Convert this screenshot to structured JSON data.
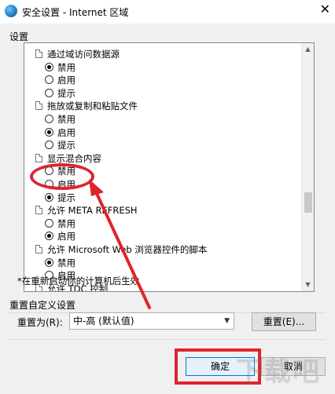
{
  "window": {
    "title": "安全设置 - Internet 区域",
    "close_glyph": "✕"
  },
  "settings_label": "设置",
  "tree": [
    {
      "kind": "heading",
      "label": "通过域访问数据源"
    },
    {
      "kind": "option",
      "label": "禁用",
      "checked": true
    },
    {
      "kind": "option",
      "label": "启用",
      "checked": false
    },
    {
      "kind": "option",
      "label": "提示",
      "checked": false
    },
    {
      "kind": "heading",
      "label": "拖放或复制和粘贴文件"
    },
    {
      "kind": "option",
      "label": "禁用",
      "checked": false
    },
    {
      "kind": "option",
      "label": "启用",
      "checked": true
    },
    {
      "kind": "option",
      "label": "提示",
      "checked": false
    },
    {
      "kind": "heading",
      "label": "显示混合内容"
    },
    {
      "kind": "option",
      "label": "禁用",
      "checked": false
    },
    {
      "kind": "option",
      "label": "启用",
      "checked": false
    },
    {
      "kind": "option",
      "label": "提示",
      "checked": true
    },
    {
      "kind": "heading",
      "label": "允许 META REFRESH"
    },
    {
      "kind": "option",
      "label": "禁用",
      "checked": false
    },
    {
      "kind": "option",
      "label": "启用",
      "checked": true
    },
    {
      "kind": "heading",
      "label": "允许 Microsoft Web 浏览器控件的脚本"
    },
    {
      "kind": "option",
      "label": "禁用",
      "checked": true
    },
    {
      "kind": "option",
      "label": "启用",
      "checked": false
    },
    {
      "kind": "heading",
      "label": "允许 TDC 控制"
    }
  ],
  "restart_note": "*在重新启动你的计算机后生效",
  "reset_group": {
    "title": "重置自定义设置",
    "reset_to_label": "重置为(R):",
    "selected": "中-高 (默认值)",
    "reset_button": "重置(E)..."
  },
  "buttons": {
    "ok": "确定",
    "cancel": "取消"
  },
  "colors": {
    "annotation_red": "#e0242c",
    "ok_border": "#0078d7"
  },
  "icons": {
    "app": "internet-globe-icon",
    "tree_item": "page-icon",
    "dropdown": "chevron-down-icon"
  }
}
